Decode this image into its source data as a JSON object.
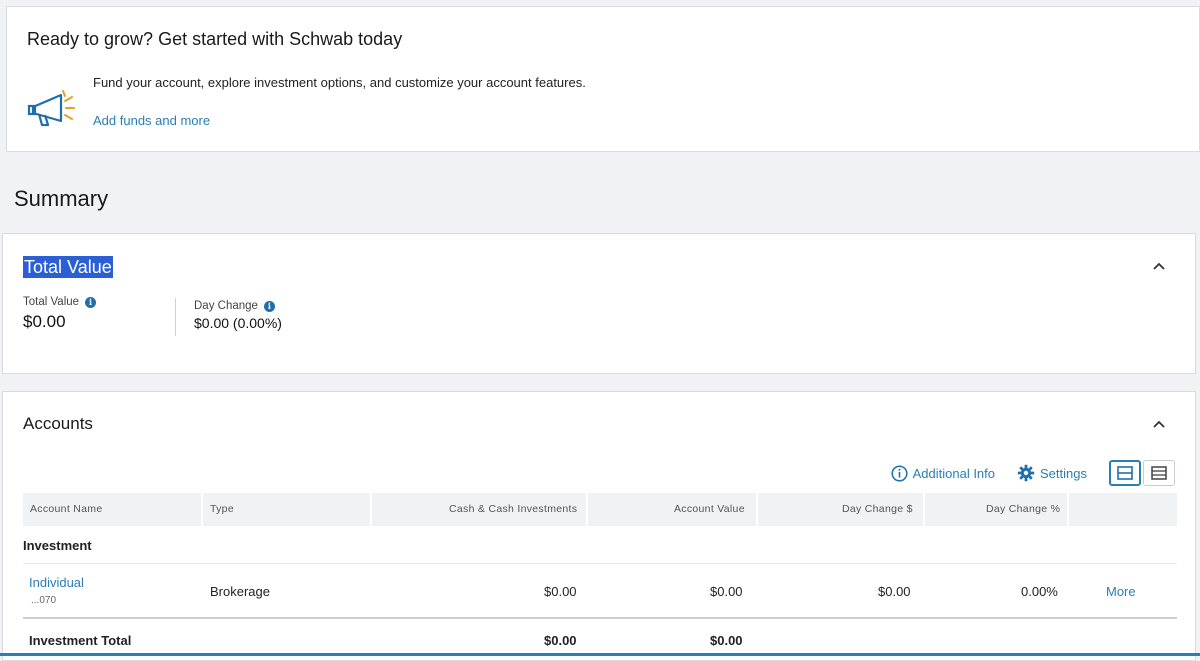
{
  "promo": {
    "title": "Ready to grow? Get started with Schwab today",
    "icon": "megaphone-icon",
    "description": "Fund your account, explore investment options, and customize your account features.",
    "link": "Add funds and more"
  },
  "summary": {
    "heading": "Summary"
  },
  "total_value_card": {
    "title": "Total Value",
    "total_value_label": "Total Value",
    "total_value": "$0.00",
    "day_change_label": "Day Change",
    "day_change": "$0.00 (0.00%)"
  },
  "accounts_card": {
    "title": "Accounts",
    "toolbar": {
      "additional_info": "Additional Info",
      "settings": "Settings"
    },
    "columns": [
      "Account Name",
      "Type",
      "Cash & Cash Investments",
      "Account Value",
      "Day Change $",
      "Day Change %"
    ],
    "group": "Investment",
    "rows": [
      {
        "name": "Individual",
        "number": "...070",
        "type": "Brokerage",
        "cash": "$0.00",
        "value": "$0.00",
        "day_change": "$0.00",
        "day_change_pct": "0.00%",
        "more": "More"
      }
    ],
    "total": {
      "label": "Investment Total",
      "cash": "$0.00",
      "value": "$0.00"
    }
  },
  "colors": {
    "link": "#2a7fb5",
    "highlight": "#2b5fd6",
    "info": "#1f6fad"
  }
}
